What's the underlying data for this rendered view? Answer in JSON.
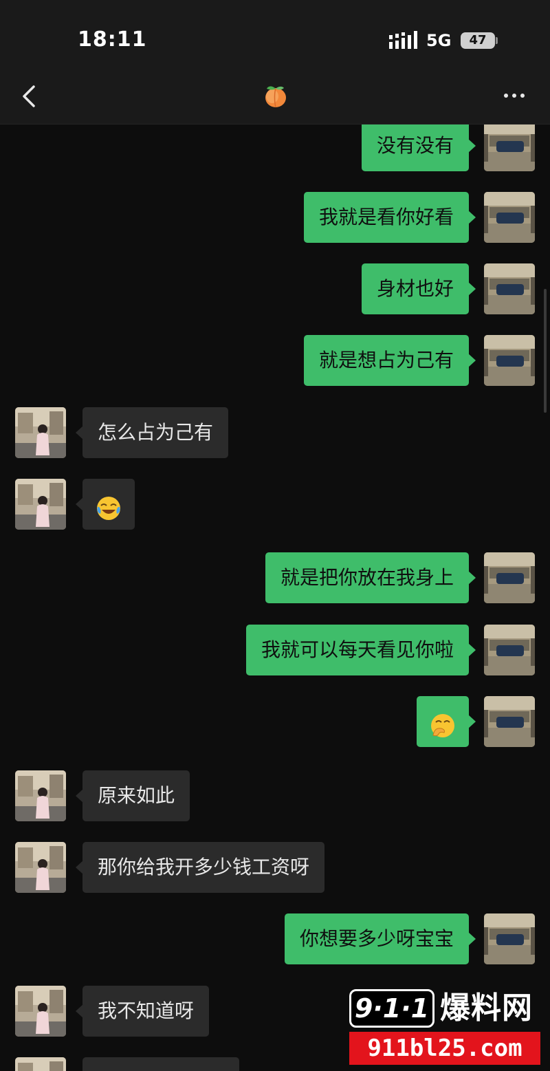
{
  "status_bar": {
    "time": "18:11",
    "network": "5G",
    "battery": "47"
  },
  "header": {
    "title_icon": "peach-emoji-icon",
    "back_icon": "chevron-left-icon",
    "more_icon": "more-dots-icon"
  },
  "messages": [
    {
      "dir": "out",
      "text": "没有没有"
    },
    {
      "dir": "out",
      "text": "我就是看你好看"
    },
    {
      "dir": "out",
      "text": "身材也好"
    },
    {
      "dir": "out",
      "text": "就是想占为己有"
    },
    {
      "dir": "in",
      "text": "怎么占为己有"
    },
    {
      "dir": "in",
      "emoji": "laughing-crying-emoji"
    },
    {
      "dir": "out",
      "text": "就是把你放在我身上"
    },
    {
      "dir": "out",
      "text": "我就可以每天看见你啦"
    },
    {
      "dir": "out",
      "emoji": "hand-over-mouth-emoji"
    },
    {
      "dir": "in",
      "text": "原来如此"
    },
    {
      "dir": "in",
      "text": "那你给我开多少钱工资呀"
    },
    {
      "dir": "out",
      "text": "你想要多少呀宝宝"
    },
    {
      "dir": "in",
      "text": "我不知道呀"
    }
  ],
  "watermark": {
    "badge": "9·1·1",
    "name": "爆料网",
    "url": "911bl25.com"
  }
}
